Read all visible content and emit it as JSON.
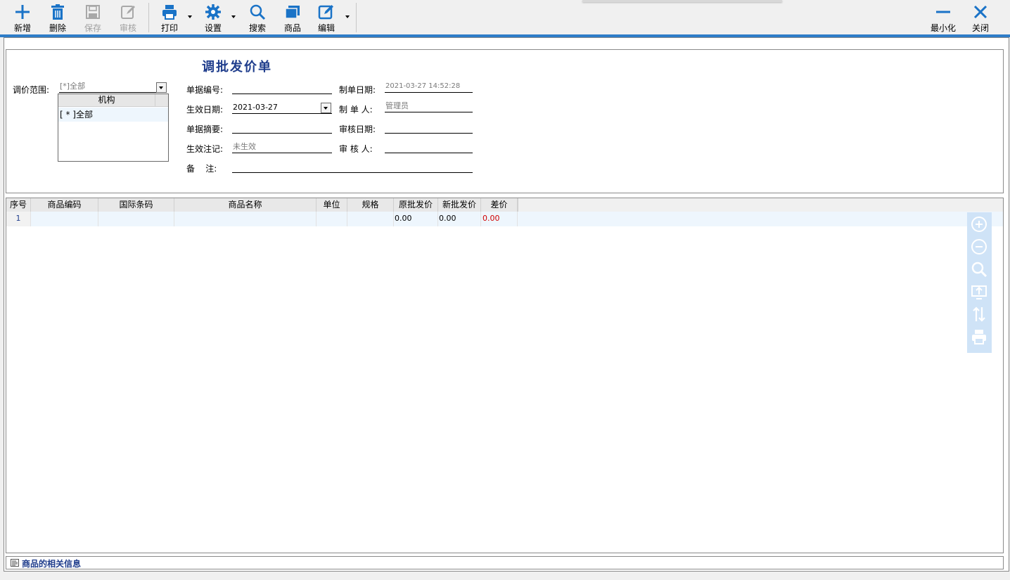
{
  "toolbar": {
    "add": "新增",
    "delete": "删除",
    "save": "保存",
    "audit": "审核",
    "print": "打印",
    "settings": "设置",
    "search": "搜索",
    "goods": "商品",
    "edit": "编辑",
    "minimize": "最小化",
    "close": "关闭"
  },
  "form": {
    "title": "调批发价单",
    "scope_label": "调价范围:",
    "scope_value": "[*]全部",
    "org_column": "机构",
    "org_option": "[ * ]全部",
    "doc_no_label": "单据编号:",
    "doc_no": "",
    "create_date_label": "制单日期:",
    "create_date": "2021-03-27 14:52:28",
    "effective_date_label": "生效日期:",
    "effective_date": "2021-03-27",
    "creator_label": "制 单 人:",
    "creator": "管理员",
    "summary_label": "单据摘要:",
    "summary": "",
    "audit_date_label": "审核日期:",
    "audit_date": "",
    "effect_flag_label": "生效注记:",
    "effect_flag": "未生效",
    "auditor_label": "审 核 人:",
    "auditor": "",
    "remark_label": "备    注:",
    "remark": ""
  },
  "grid": {
    "columns": [
      "序号",
      "商品编码",
      "国际条码",
      "商品名称",
      "单位",
      "规格",
      "原批发价",
      "新批发价",
      "差价"
    ],
    "rows": [
      {
        "seq": "1",
        "code": "",
        "barcode": "",
        "name": "",
        "unit": "",
        "spec": "",
        "old_price": "0.00",
        "new_price": "0.00",
        "diff": "0.00"
      }
    ]
  },
  "side_tools": [
    "zoom-in-icon",
    "zoom-out-icon",
    "search-icon",
    "export-icon",
    "sort-icon",
    "print-icon"
  ],
  "footer": {
    "text": "商品的相关信息"
  },
  "colors": {
    "accent": "#2e7dc8",
    "title": "#1f3d8c",
    "diff_negative": "#d00000"
  }
}
